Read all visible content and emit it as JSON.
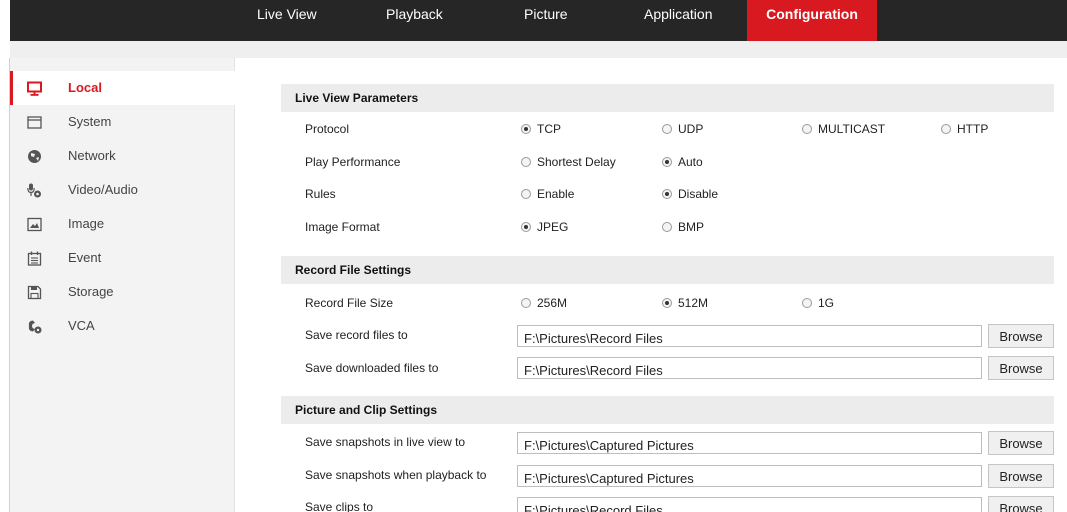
{
  "nav": {
    "tabs": [
      {
        "label": "Live View"
      },
      {
        "label": "Playback"
      },
      {
        "label": "Picture"
      },
      {
        "label": "Application"
      },
      {
        "label": "Configuration"
      }
    ],
    "active": "Configuration",
    "accent_color": "#d8191f",
    "bar_color": "#262626"
  },
  "sidebar": {
    "items": [
      {
        "label": "Local",
        "icon": "monitor-icon"
      },
      {
        "label": "System",
        "icon": "system-window-icon"
      },
      {
        "label": "Network",
        "icon": "globe-icon"
      },
      {
        "label": "Video/Audio",
        "icon": "microphone-camera-icon"
      },
      {
        "label": "Image",
        "icon": "picture-icon"
      },
      {
        "label": "Event",
        "icon": "calendar-icon"
      },
      {
        "label": "Storage",
        "icon": "floppy-disk-icon"
      },
      {
        "label": "VCA",
        "icon": "vca-icon"
      }
    ],
    "active": "Local"
  },
  "live_view": {
    "title": "Live View Parameters",
    "protocol": {
      "label": "Protocol",
      "options": [
        "TCP",
        "UDP",
        "MULTICAST",
        "HTTP"
      ],
      "selected": "TCP"
    },
    "play_performance": {
      "label": "Play Performance",
      "options": [
        "Shortest Delay",
        "Auto"
      ],
      "selected": "Auto"
    },
    "rules": {
      "label": "Rules",
      "options": [
        "Enable",
        "Disable"
      ],
      "selected": "Disable"
    },
    "image_format": {
      "label": "Image Format",
      "options": [
        "JPEG",
        "BMP"
      ],
      "selected": "JPEG"
    }
  },
  "record": {
    "title": "Record File Settings",
    "file_size": {
      "label": "Record File Size",
      "options": [
        "256M",
        "512M",
        "1G"
      ],
      "selected": "512M"
    },
    "save_record": {
      "label": "Save record files to",
      "value": "F:\\Pictures\\Record Files"
    },
    "save_downloaded": {
      "label": "Save downloaded files to",
      "value": "F:\\Pictures\\Record Files"
    }
  },
  "picture_clip": {
    "title": "Picture and Clip Settings",
    "save_snap_live": {
      "label": "Save snapshots in live view to",
      "value": "F:\\Pictures\\Captured Pictures"
    },
    "save_snap_playback": {
      "label": "Save snapshots when playback to",
      "value": "F:\\Pictures\\Captured Pictures"
    },
    "save_clips": {
      "label": "Save clips to",
      "value": "F:\\Pictures\\Record Files"
    }
  },
  "browse_label": "Browse"
}
